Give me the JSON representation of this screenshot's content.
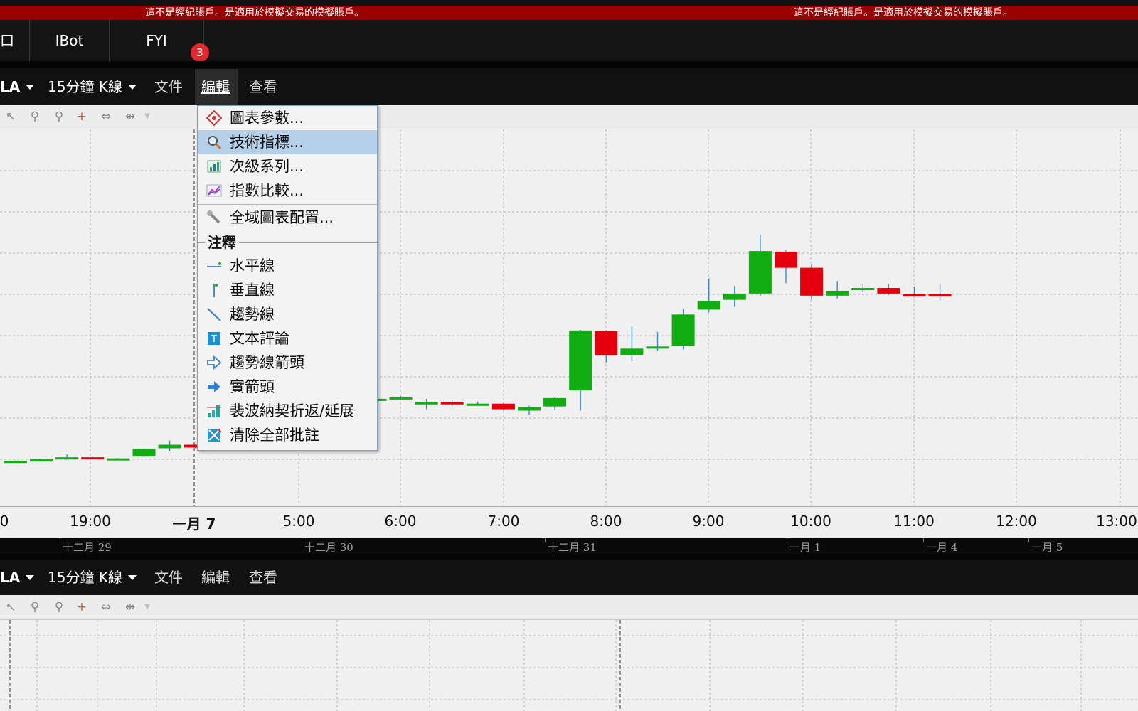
{
  "banner": {
    "left_text": "這不是經紀賬戶。是適用於模擬交易的模擬賬戶。",
    "right_text": "這不是經紀賬戶。是適用於模擬交易的模擬賬戶。"
  },
  "tabs": [
    {
      "label": "口"
    },
    {
      "label": "IBot"
    },
    {
      "label": "FYI",
      "badge": "3"
    }
  ],
  "chart1": {
    "symbol": "LA",
    "interval": "15分鐘 K線",
    "menus": [
      "文件",
      "編輯",
      "查看"
    ]
  },
  "chart2": {
    "symbol": "LA",
    "interval": "15分鐘 K線",
    "menus": [
      "文件",
      "編輯",
      "查看"
    ]
  },
  "toolbar_icons": [
    "cursor-icon",
    "zoom-in-icon",
    "zoom-out-icon",
    "crosshair-icon",
    "pan-icon",
    "fit-icon"
  ],
  "edit_menu": {
    "items_top": [
      {
        "label": "圖表參數...",
        "icon": "chart-params-icon"
      },
      {
        "label": "技術指標...",
        "icon": "magnifier-icon",
        "highlighted": true
      },
      {
        "label": "次級系列...",
        "icon": "secondary-series-icon"
      },
      {
        "label": "指數比較...",
        "icon": "index-compare-icon"
      }
    ],
    "global_item": {
      "label": "全域圖表配置...",
      "icon": "wrench-icon"
    },
    "annotation_header": "注釋",
    "annotation_items": [
      {
        "label": "水平線",
        "icon": "horizontal-line-icon"
      },
      {
        "label": "垂直線",
        "icon": "vertical-line-icon"
      },
      {
        "label": "趨勢線",
        "icon": "trend-line-icon"
      },
      {
        "label": "文本評論",
        "icon": "text-comment-icon"
      },
      {
        "label": "趨勢線箭頭",
        "icon": "outline-arrow-icon"
      },
      {
        "label": "實箭頭",
        "icon": "solid-arrow-icon"
      },
      {
        "label": "裴波納契折返/延展",
        "icon": "fibonacci-icon"
      },
      {
        "label": "清除全部批註",
        "icon": "clear-annotations-icon"
      }
    ]
  },
  "time_axis": [
    "0",
    "19:00",
    "一月 7",
    "5:00",
    "6:00",
    "7:00",
    "8:00",
    "9:00",
    "10:00",
    "11:00",
    "12:00",
    "13:00"
  ],
  "date_strip": [
    "十二月 29",
    "十二月 30",
    "十二月 31",
    "一月 1",
    "一月 4",
    "一月 5"
  ],
  "colors": {
    "up": "#12ad12",
    "down": "#e3000c",
    "wick": "#3a8ad6",
    "banner": "#9a0000",
    "menu_highlight": "#b7d0ea"
  },
  "chart_data": {
    "type": "candlestick",
    "note": "price axis not visible; values in relative units",
    "candles": [
      {
        "o": 0.2,
        "c": 0.4,
        "h": 0.45,
        "l": 0.15
      },
      {
        "o": 0.4,
        "c": 0.6,
        "h": 0.65,
        "l": 0.35
      },
      {
        "o": 0.6,
        "c": 0.9,
        "h": 1.3,
        "l": 0.55
      },
      {
        "o": 0.9,
        "c": 0.75,
        "h": 0.95,
        "l": 0.7
      },
      {
        "o": 0.75,
        "c": 0.75,
        "h": 0.8,
        "l": 0.7
      },
      {
        "o": 1.0,
        "c": 2.1,
        "h": 2.2,
        "l": 0.95
      },
      {
        "o": 2.2,
        "c": 2.7,
        "h": 3.3,
        "l": 1.8
      },
      {
        "o": 2.7,
        "c": 2.3,
        "h": 2.8,
        "l": 2.2
      },
      {
        "o": 10.2,
        "c": 9.6,
        "h": 10.8,
        "l": 9.5
      },
      {
        "o": 9.7,
        "c": 9.4,
        "h": 9.8,
        "l": 9.3
      },
      {
        "o": 9.0,
        "c": 9.2,
        "h": 9.3,
        "l": 7.7
      },
      {
        "o": 9.2,
        "c": 9.0,
        "h": 9.3,
        "l": 8.9
      },
      {
        "o": 9.1,
        "c": 9.2,
        "h": 9.3,
        "l": 9.0
      },
      {
        "o": 9.1,
        "c": 9.1,
        "h": 9.2,
        "l": 8.0
      },
      {
        "o": 9.1,
        "c": 9.3,
        "h": 9.4,
        "l": 8.8
      },
      {
        "o": 9.3,
        "c": 9.5,
        "h": 9.7,
        "l": 9.2
      },
      {
        "o": 8.5,
        "c": 8.8,
        "h": 9.3,
        "l": 7.8
      },
      {
        "o": 8.8,
        "c": 8.7,
        "h": 9.2,
        "l": 8.3
      },
      {
        "o": 8.5,
        "c": 8.6,
        "h": 8.9,
        "l": 8.4
      },
      {
        "o": 8.6,
        "c": 7.8,
        "h": 8.7,
        "l": 7.6
      },
      {
        "o": 7.6,
        "c": 8.1,
        "h": 8.3,
        "l": 7.0
      },
      {
        "o": 8.2,
        "c": 9.4,
        "h": 9.5,
        "l": 7.7
      },
      {
        "o": 10.5,
        "c": 19.1,
        "h": 19.2,
        "l": 7.6
      },
      {
        "o": 19.0,
        "c": 15.5,
        "h": 19.1,
        "l": 14.5
      },
      {
        "o": 15.6,
        "c": 16.5,
        "h": 19.7,
        "l": 14.7
      },
      {
        "o": 16.6,
        "c": 16.8,
        "h": 18.9,
        "l": 16.2
      },
      {
        "o": 16.9,
        "c": 21.4,
        "h": 22.2,
        "l": 16.4
      },
      {
        "o": 22.1,
        "c": 23.3,
        "h": 26.6,
        "l": 21.7
      },
      {
        "o": 23.5,
        "c": 24.4,
        "h": 25.5,
        "l": 22.5
      },
      {
        "o": 24.4,
        "c": 30.5,
        "h": 32.8,
        "l": 24.1
      },
      {
        "o": 30.4,
        "c": 28.1,
        "h": 30.6,
        "l": 25.9
      },
      {
        "o": 28.1,
        "c": 24.1,
        "h": 28.6,
        "l": 23.5
      },
      {
        "o": 24.1,
        "c": 24.8,
        "h": 26.2,
        "l": 23.7
      },
      {
        "o": 24.9,
        "c": 25.2,
        "h": 25.7,
        "l": 24.6
      },
      {
        "o": 25.2,
        "c": 24.4,
        "h": 25.8,
        "l": 24.2
      },
      {
        "o": 24.3,
        "c": 24.2,
        "h": 25.4,
        "l": 23.9
      },
      {
        "o": 24.3,
        "c": 24.1,
        "h": 25.7,
        "l": 23.4
      }
    ]
  }
}
